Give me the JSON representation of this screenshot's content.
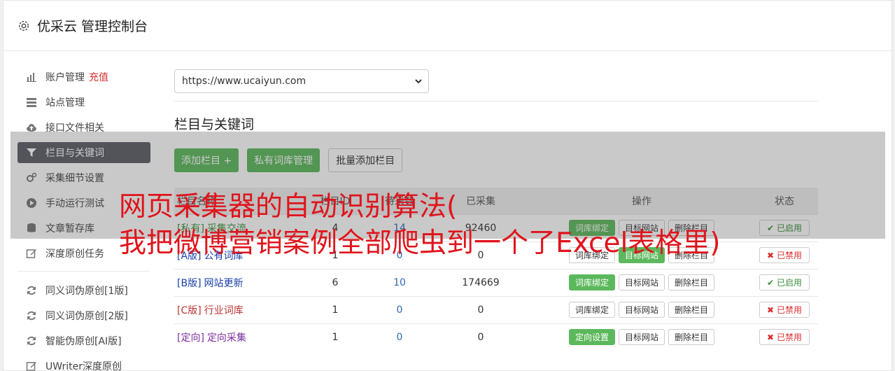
{
  "header": {
    "title": "优采云 管理控制台",
    "icon": "gear-icon"
  },
  "sidebar": {
    "items": [
      {
        "label": "账户管理",
        "extra": "充值",
        "icon": "bar-chart-icon"
      },
      {
        "label": "站点管理",
        "icon": "server-icon"
      },
      {
        "label": "接口文件相关",
        "icon": "cloud-upload-icon"
      },
      {
        "label": "栏目与关键词",
        "icon": "filter-icon",
        "active": true
      },
      {
        "label": "采集细节设置",
        "icon": "cogs-icon"
      },
      {
        "label": "手动运行测试",
        "icon": "play-circle-icon"
      },
      {
        "label": "文章暂存库",
        "icon": "database-icon"
      },
      {
        "label": "深度原创任务",
        "icon": "edit-icon"
      }
    ],
    "items2": [
      {
        "label": "同义词伪原创[1版]",
        "icon": "refresh-icon"
      },
      {
        "label": "同义词伪原创[2版]",
        "icon": "refresh-icon"
      },
      {
        "label": "智能伪原创[AI版]",
        "icon": "refresh-icon"
      },
      {
        "label": "UWriter深度原创",
        "icon": "edit-icon"
      }
    ]
  },
  "main": {
    "site_select": "https://www.ucaiyun.com",
    "section_title": "栏目与关键词",
    "buttons": {
      "add_column": "添加栏目 +",
      "private_lib": "私有词库管理",
      "batch_add": "批量添加栏目"
    },
    "table": {
      "headers": [
        "栏目名称",
        "栏目ID",
        "待采数",
        "已采集",
        "操作",
        "状态"
      ],
      "rows": [
        {
          "tag": "[私有]",
          "name": "采集交流",
          "id": "4",
          "pending": "14",
          "collected": "92460",
          "op1": "词库绑定",
          "op2": "目标网站",
          "op3": "删除栏目",
          "status": "已启用"
        },
        {
          "tag": "[A版]",
          "name": "公有词库",
          "id": "1",
          "pending": "0",
          "collected": "0",
          "op1": "词库绑定",
          "op2": "目标网站",
          "op3": "删除栏目",
          "status": "已禁用"
        },
        {
          "tag": "[B版]",
          "name": "网站更新",
          "id": "6",
          "pending": "10",
          "collected": "174669",
          "op1": "词库绑定",
          "op2": "目标网站",
          "op3": "删除栏目",
          "status": "已启用"
        },
        {
          "tag": "[C版]",
          "name": "行业词库",
          "id": "1",
          "pending": "0",
          "collected": "0",
          "op1": "词库绑定",
          "op2": "目标网站",
          "op3": "删除栏目",
          "status": "已禁用"
        },
        {
          "tag": "[定向]",
          "name": "定向采集",
          "id": "1",
          "pending": "0",
          "collected": "0",
          "op1": "定向设置",
          "op2": "目标网站",
          "op3": "删除栏目",
          "status": "已禁用"
        }
      ]
    }
  },
  "overlay_text": {
    "line1": "网页采集器的自动识别算法(",
    "line2": "我把微博营销案例全部爬虫到一个了Excel表格里)"
  },
  "colors": {
    "green": "#5cb85c",
    "red": "#d9302f",
    "sidebar_active": "#5a5e66",
    "overlay_text": "#e0141c"
  }
}
